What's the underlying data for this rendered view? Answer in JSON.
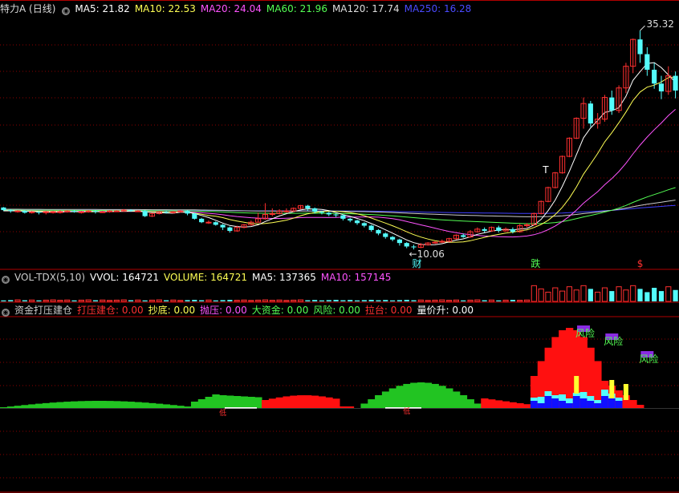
{
  "colors": {
    "bg": "#000000",
    "up": "#ff3030",
    "down": "#54fcfc",
    "grid": "#8b0000",
    "axis": "#b00000",
    "ma5": "#ffffff",
    "ma10": "#ffff54",
    "ma20": "#ff54ff",
    "ma60": "#54ff54",
    "ma120": "#cccccc",
    "ma250": "#4040ff"
  },
  "header": {
    "title": "特力A (日线)",
    "ma5": "MA5: 21.82",
    "ma10": "MA10: 22.53",
    "ma20": "MA20: 24.04",
    "ma60": "MA60: 21.96",
    "ma120": "MA120: 17.74",
    "ma250": "MA250: 16.28"
  },
  "vol_header": {
    "name": "VOL-TDX(5,10)",
    "vvol": "VVOL: 164721",
    "volume": "VOLUME: 164721",
    "ma5": "MA5: 137365",
    "ma10": "MA10: 157145"
  },
  "ind_header": {
    "name": "资金打压建仓",
    "dy": "打压建仓: 0.00",
    "cd": "抄底: 0.00",
    "py": "抛压: 0.00",
    "dzj": "大资金: 0.00",
    "fx": "风险: 0.00",
    "lt": "拉台: 0.00",
    "ljs": "量价升: 0.00"
  },
  "annotations": {
    "high": "35.32",
    "low": "10.06",
    "cai": "财",
    "die": "跌",
    "s": "$",
    "t": "T",
    "risk": "风险",
    "low_mark": "低"
  },
  "chart_data": [
    {
      "type": "candlestick",
      "title": "特力A (日线)",
      "ylim": [
        8.5,
        37
      ],
      "price_high": 35.32,
      "price_low": 10.06,
      "n": 96,
      "candles": [
        [
          14.9,
          14.6,
          14.95,
          14.5
        ],
        [
          14.6,
          14.5,
          14.7,
          14.3
        ],
        [
          14.5,
          14.5,
          14.6,
          14.3
        ],
        [
          14.5,
          14.3,
          14.6,
          14.2
        ],
        [
          14.3,
          14.4,
          14.5,
          14.2
        ],
        [
          14.4,
          14.3,
          14.5,
          14.1
        ],
        [
          14.3,
          14.4,
          14.5,
          14.1
        ],
        [
          14.4,
          14.4,
          14.5,
          14.2
        ],
        [
          14.4,
          14.4,
          14.6,
          14.2
        ],
        [
          14.4,
          14.5,
          14.6,
          14.3
        ],
        [
          14.5,
          14.4,
          14.6,
          14.3
        ],
        [
          14.4,
          14.4,
          14.5,
          14.2
        ],
        [
          14.4,
          14.5,
          14.6,
          14.3
        ],
        [
          14.5,
          14.4,
          14.6,
          14.2
        ],
        [
          14.4,
          14.4,
          14.5,
          14.3
        ],
        [
          14.4,
          14.5,
          14.6,
          14.3
        ],
        [
          14.5,
          14.5,
          14.6,
          14.4
        ],
        [
          14.5,
          14.6,
          14.7,
          14.4
        ],
        [
          14.6,
          14.5,
          14.7,
          14.4
        ],
        [
          14.5,
          14.5,
          14.6,
          14.4
        ],
        [
          14.5,
          13.9,
          14.6,
          13.8
        ],
        [
          13.9,
          14.2,
          14.3,
          13.8
        ],
        [
          14.2,
          14.4,
          14.5,
          14.1
        ],
        [
          14.4,
          14.3,
          14.5,
          14.2
        ],
        [
          14.3,
          14.4,
          14.5,
          14.2
        ],
        [
          14.4,
          14.5,
          14.6,
          14.3
        ],
        [
          14.5,
          14.2,
          14.6,
          14.0
        ],
        [
          14.2,
          13.6,
          14.3,
          13.5
        ],
        [
          13.6,
          13.2,
          13.7,
          13.1
        ],
        [
          13.2,
          13.2,
          13.4,
          13.0
        ],
        [
          13.2,
          12.9,
          13.3,
          12.8
        ],
        [
          12.9,
          12.6,
          13.0,
          12.3
        ],
        [
          12.6,
          12.2,
          12.7,
          12.0
        ],
        [
          12.2,
          12.6,
          12.8,
          12.1
        ],
        [
          12.6,
          12.9,
          13.0,
          12.5
        ],
        [
          12.9,
          13.2,
          13.4,
          12.8
        ],
        [
          13.2,
          13.6,
          14.3,
          13.2
        ],
        [
          13.6,
          14.1,
          15.4,
          13.5
        ],
        [
          14.1,
          14.2,
          14.8,
          13.9
        ],
        [
          14.2,
          14.5,
          14.7,
          14.1
        ],
        [
          14.5,
          14.5,
          14.8,
          14.3
        ],
        [
          14.5,
          14.8,
          14.9,
          14.4
        ],
        [
          14.8,
          15.1,
          15.2,
          14.7
        ],
        [
          15.1,
          14.8,
          15.2,
          14.5
        ],
        [
          14.8,
          14.4,
          14.9,
          14.2
        ],
        [
          14.4,
          14.3,
          14.5,
          14.1
        ],
        [
          14.3,
          14.1,
          14.4,
          13.9
        ],
        [
          14.1,
          14.0,
          14.2,
          13.8
        ],
        [
          14.0,
          13.6,
          14.1,
          13.4
        ],
        [
          13.6,
          13.4,
          13.7,
          13.2
        ],
        [
          13.4,
          13.1,
          13.5,
          12.9
        ],
        [
          13.1,
          12.8,
          13.2,
          12.6
        ],
        [
          12.8,
          12.3,
          12.9,
          12.1
        ],
        [
          12.3,
          11.9,
          12.4,
          11.7
        ],
        [
          11.9,
          11.5,
          12.0,
          11.3
        ],
        [
          11.5,
          11.2,
          11.6,
          11.0
        ],
        [
          11.2,
          10.8,
          11.3,
          10.5
        ],
        [
          10.8,
          10.4,
          10.9,
          10.2
        ],
        [
          10.4,
          10.3,
          10.6,
          10.06
        ],
        [
          10.3,
          10.6,
          10.8,
          10.2
        ],
        [
          10.6,
          10.8,
          10.9,
          10.5
        ],
        [
          10.8,
          10.9,
          11.0,
          10.7
        ],
        [
          10.9,
          11.0,
          11.2,
          10.8
        ],
        [
          11.0,
          11.3,
          11.4,
          10.9
        ],
        [
          11.3,
          11.7,
          11.8,
          11.2
        ],
        [
          11.7,
          11.5,
          11.9,
          11.4
        ],
        [
          11.5,
          12.1,
          12.3,
          11.4
        ],
        [
          12.1,
          12.4,
          12.6,
          12.0
        ],
        [
          12.4,
          12.2,
          12.6,
          12.0
        ],
        [
          12.2,
          12.6,
          12.7,
          12.1
        ],
        [
          12.6,
          12.2,
          12.8,
          12.0
        ],
        [
          12.2,
          12.4,
          12.6,
          12.1
        ],
        [
          12.4,
          12.1,
          12.6,
          11.9
        ],
        [
          12.1,
          12.8,
          13.0,
          12.0
        ],
        [
          12.8,
          12.9,
          13.1,
          12.6
        ],
        [
          12.9,
          14.2,
          14.3,
          12.8
        ],
        [
          14.2,
          15.6,
          15.7,
          14.1
        ],
        [
          15.6,
          17.2,
          17.3,
          15.5
        ],
        [
          17.2,
          18.9,
          19.0,
          17.1
        ],
        [
          18.9,
          20.8,
          20.9,
          18.8
        ],
        [
          20.8,
          22.9,
          23.0,
          20.7
        ],
        [
          22.9,
          25.2,
          25.3,
          22.8
        ],
        [
          25.2,
          26.9,
          27.6,
          24.0
        ],
        [
          26.9,
          24.6,
          27.2,
          24.2
        ],
        [
          24.6,
          25.1,
          25.8,
          24.0
        ],
        [
          25.1,
          27.6,
          27.9,
          24.8
        ],
        [
          27.6,
          26.1,
          28.4,
          25.6
        ],
        [
          26.1,
          28.7,
          29.0,
          25.8
        ],
        [
          28.7,
          31.2,
          31.6,
          28.1
        ],
        [
          31.2,
          34.3,
          34.4,
          30.4
        ],
        [
          34.3,
          32.6,
          35.32,
          31.6
        ],
        [
          32.6,
          30.8,
          33.4,
          30.1
        ],
        [
          30.8,
          29.2,
          31.6,
          28.6
        ],
        [
          29.2,
          28.3,
          30.1,
          27.4
        ],
        [
          28.3,
          30.1,
          31.2,
          27.9
        ],
        [
          30.1,
          28.4,
          30.6,
          27.5
        ]
      ],
      "ma_series": [
        "MA5",
        "MA10",
        "MA20",
        "MA60",
        "MA120",
        "MA250"
      ]
    },
    {
      "type": "bar",
      "title": "VOL-TDX(5,10)",
      "values_relative": "volume bars, low then rising on breakout",
      "ylim": [
        0,
        1
      ]
    },
    {
      "type": "bar",
      "title": "资金打压建仓",
      "series": [
        {
          "name": "打压建仓",
          "values": []
        },
        {
          "name": "大资金",
          "values": []
        }
      ]
    }
  ]
}
